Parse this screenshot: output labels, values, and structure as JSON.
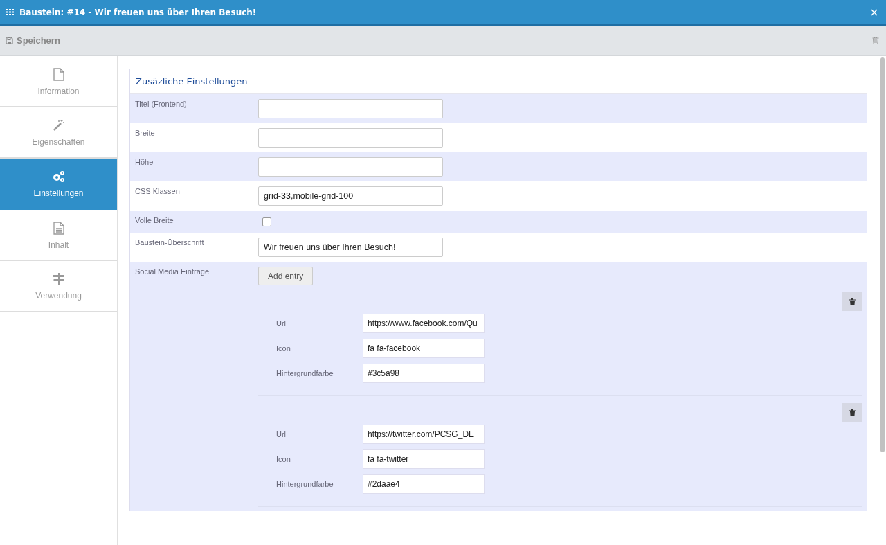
{
  "window": {
    "title": "Baustein: #14 - Wir freuen uns über Ihren Besuch!"
  },
  "toolbar": {
    "save_label": "Speichern"
  },
  "sidebar": {
    "items": [
      {
        "label": "Information",
        "kind": "file",
        "selected": false
      },
      {
        "label": "Eigenschaften",
        "kind": "wand",
        "selected": false
      },
      {
        "label": "Einstellungen",
        "kind": "gears",
        "selected": true
      },
      {
        "label": "Inhalt",
        "kind": "doc",
        "selected": false
      },
      {
        "label": "Verwendung",
        "kind": "signpost",
        "selected": false
      }
    ]
  },
  "panel": {
    "title": "Zusäzliche Einstellungen",
    "rows": [
      {
        "kind": "text",
        "label": "Titel (Frontend)",
        "value": ""
      },
      {
        "kind": "text",
        "label": "Breite",
        "value": ""
      },
      {
        "kind": "text",
        "label": "Höhe",
        "value": ""
      },
      {
        "kind": "text",
        "label": "CSS Klassen",
        "value": "grid-33,mobile-grid-100"
      },
      {
        "kind": "checkbox",
        "label": "Volle Breite",
        "checked": false
      },
      {
        "kind": "text",
        "label": "Baustein-Überschrift",
        "value": "Wir freuen uns über Ihren Besuch!"
      },
      {
        "kind": "entries",
        "label": "Social Media Einträge",
        "button": "Add entry",
        "entries": [
          {
            "fields": [
              {
                "label": "Url",
                "value": "https://www.facebook.com/Qu"
              },
              {
                "label": "Icon",
                "value": "fa fa-facebook"
              },
              {
                "label": "Hintergrundfarbe",
                "value": "#3c5a98"
              }
            ]
          },
          {
            "fields": [
              {
                "label": "Url",
                "value": "https://twitter.com/PCSG_DE"
              },
              {
                "label": "Icon",
                "value": "fa fa-twitter"
              },
              {
                "label": "Hintergrundfarbe",
                "value": "#2daae4"
              }
            ]
          }
        ]
      }
    ]
  }
}
